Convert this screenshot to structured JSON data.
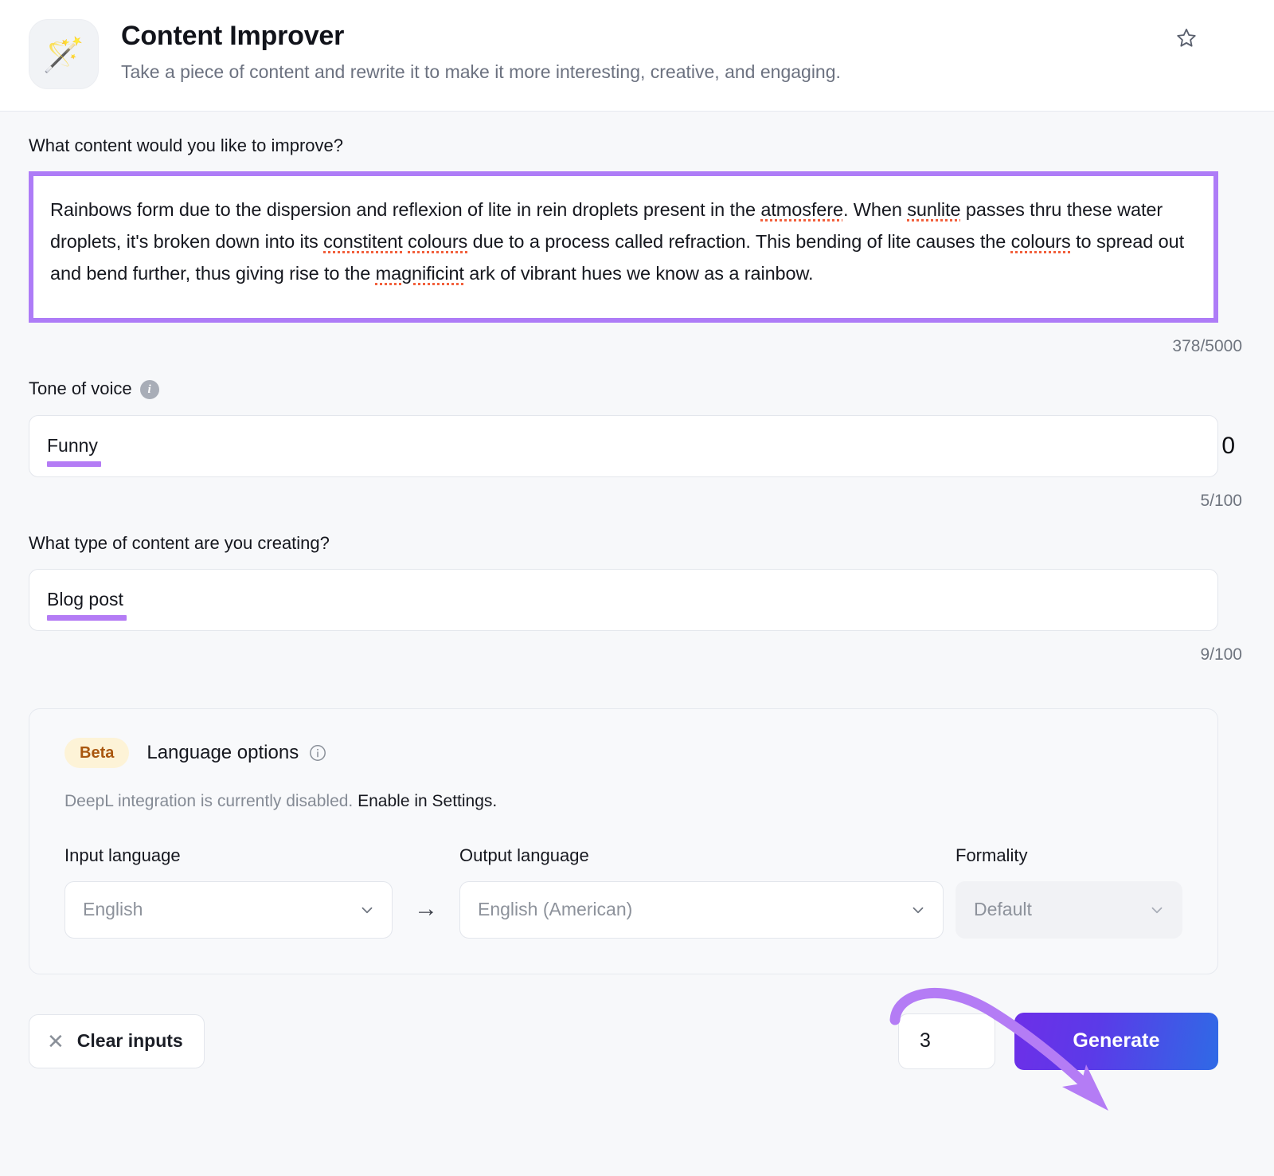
{
  "header": {
    "icon": "magic-wand-icon",
    "icon_glyph": "🪄",
    "title": "Content Improver",
    "subtitle": "Take a piece of content and rewrite it to make it more interesting, creative, and engaging.",
    "favorite_icon": "star-outline-icon"
  },
  "content_field": {
    "label": "What content would you like to improve?",
    "segments": [
      {
        "text": "Rainbows form due to the dispersion and reflexion of lite in rein droplets present in the ",
        "misspelled": false
      },
      {
        "text": "atmosfere",
        "misspelled": true
      },
      {
        "text": ". When ",
        "misspelled": false
      },
      {
        "text": "sunlite",
        "misspelled": true
      },
      {
        "text": " passes thru these water droplets, it's broken down into its ",
        "misspelled": false
      },
      {
        "text": "constitent",
        "misspelled": true
      },
      {
        "text": " ",
        "misspelled": false
      },
      {
        "text": "colours",
        "misspelled": true
      },
      {
        "text": " due to a process called refraction. This bending of lite causes the ",
        "misspelled": false
      },
      {
        "text": "colours",
        "misspelled": true
      },
      {
        "text": " to spread out and bend further, thus giving rise to the ",
        "misspelled": false
      },
      {
        "text": "magnificint",
        "misspelled": true
      },
      {
        "text": " ark of vibrant hues we know as a rainbow.",
        "misspelled": false
      }
    ],
    "counter": "378/5000",
    "highlight_color": "#ae7cf7"
  },
  "tone_field": {
    "label": "Tone of voice",
    "info_icon": "info-icon",
    "value": "Funny",
    "counter": "5/100",
    "clipped_char": "0",
    "underline_color": "#b47cf5"
  },
  "content_type_field": {
    "label": "What type of content are you creating?",
    "value": "Blog post",
    "counter": "9/100",
    "underline_color": "#b47cf5"
  },
  "language_options": {
    "badge": "Beta",
    "title": "Language options",
    "info_icon": "info-icon",
    "note_disabled": "DeepL integration is currently disabled.",
    "note_link": "Enable in Settings.",
    "input_language": {
      "label": "Input language",
      "value": "English"
    },
    "arrow": "→",
    "output_language": {
      "label": "Output language",
      "value": "English (American)"
    },
    "formality": {
      "label": "Formality",
      "value": "Default"
    },
    "badge_bg": "#fdf3d7",
    "badge_color": "#a9570f"
  },
  "footer": {
    "clear_label": "Clear inputs",
    "clear_icon": "close-x-icon",
    "count_value": "3",
    "generate_label": "Generate",
    "generate_gradient_from": "#6d2fe8",
    "generate_gradient_to": "#2f6ae6"
  },
  "annotation": {
    "arrow_color": "#b47cf5",
    "box_color": "#ae7cf7"
  }
}
